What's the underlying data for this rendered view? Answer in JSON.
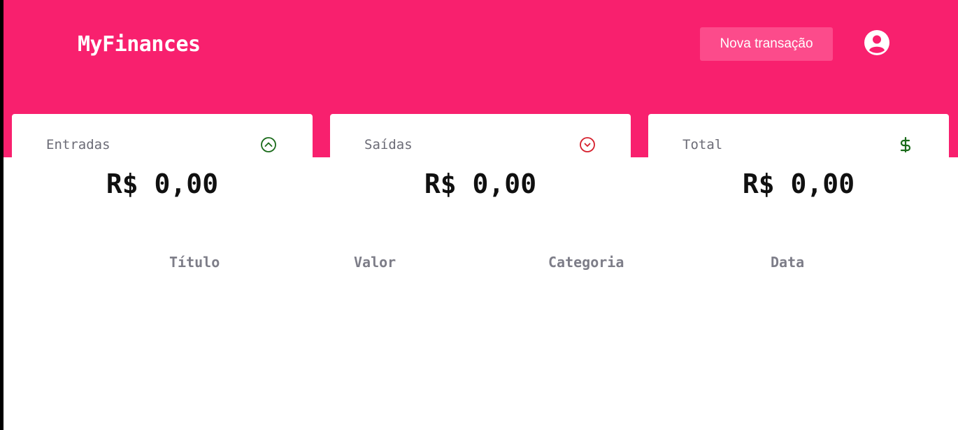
{
  "header": {
    "logo": "MyFinances",
    "new_transaction_label": "Nova transação",
    "user_icon": "user-circle-icon",
    "background": "#f8206e",
    "button_background": "#fc4b8b"
  },
  "summary": {
    "income": {
      "label": "Entradas",
      "value": "R$ 0,00",
      "icon": "arrow-up-circle-icon",
      "icon_color": "#1a6b1a"
    },
    "outcome": {
      "label": "Saídas",
      "value": "R$ 0,00",
      "icon": "arrow-down-circle-icon",
      "icon_color": "#d61f2c"
    },
    "total": {
      "label": "Total",
      "value": "R$ 0,00",
      "icon": "dollar-sign-icon",
      "icon_color": "#1a6b1a"
    }
  },
  "table": {
    "columns": [
      "Título",
      "Valor",
      "Categoria",
      "Data"
    ]
  }
}
